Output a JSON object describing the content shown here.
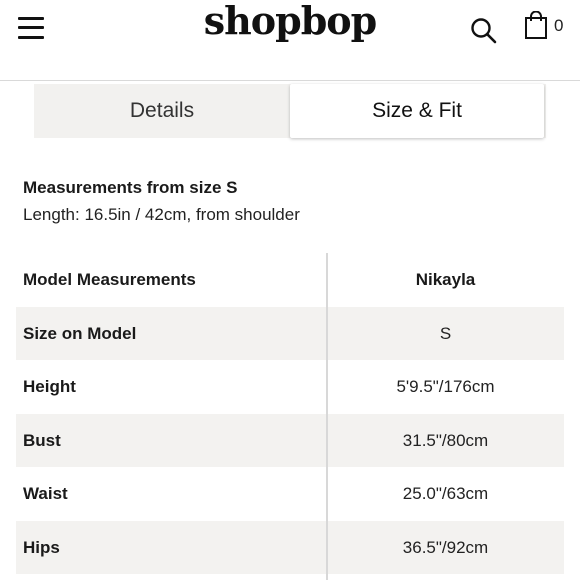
{
  "header": {
    "logo": "shopbop",
    "bag_count": "0"
  },
  "tabs": [
    {
      "label": "Details",
      "active": false
    },
    {
      "label": "Size & Fit",
      "active": true
    }
  ],
  "measurements": {
    "title": "Measurements from size S",
    "length": "Length: 16.5in / 42cm, from shoulder"
  },
  "model_table": {
    "header": {
      "label": "Model Measurements",
      "value": "Nikayla"
    },
    "rows": [
      {
        "label": "Size on Model",
        "value": "S"
      },
      {
        "label": "Height",
        "value": "5'9.5\"/176cm"
      },
      {
        "label": "Bust",
        "value": "31.5\"/80cm"
      },
      {
        "label": "Waist",
        "value": "25.0\"/63cm"
      },
      {
        "label": "Hips",
        "value": "36.5\"/92cm"
      }
    ]
  },
  "colors": {
    "tab_background": "#f2f1ef",
    "row_shade": "#f3f2f0",
    "text": "#1a1a1a"
  }
}
